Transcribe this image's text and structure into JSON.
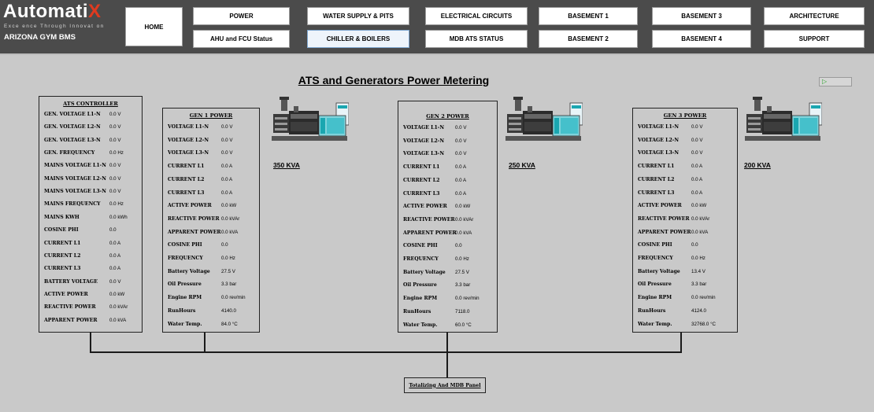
{
  "brand": {
    "logo_main": "Automati",
    "logo_x": "X",
    "tagline": "Exce ence Through Innovat on",
    "site_name": "ARIZONA GYM BMS"
  },
  "nav": {
    "home": "HOME",
    "row1": [
      "POWER",
      "WATER SUPPLY & PITS",
      "ELECTRICAL CIRCUITS",
      "BASEMENT 1",
      "BASEMENT 3",
      "ARCHITECTURE"
    ],
    "row2": [
      "AHU and FCU Status",
      "CHILLER & BOILERS",
      "MDB ATS STATUS",
      "BASEMENT 2",
      "BASEMENT 4",
      "SUPPORT"
    ]
  },
  "page": {
    "title": "ATS and Generators Power Metering",
    "indicator": "▷"
  },
  "ats": {
    "title": "ATS CONTROLLER",
    "rows": [
      {
        "label": "GEN. VOLTAGE L1-N",
        "value": "0.0 V"
      },
      {
        "label": "GEN. VOLTAGE L2-N",
        "value": "0.0 V"
      },
      {
        "label": "GEN. VOLTAGE L3-N",
        "value": "0.0 V"
      },
      {
        "label": "GEN. FREQUENCY",
        "value": "0.0 Hz"
      },
      {
        "label": "MAINS VOLTAGE L1-N",
        "value": "0.0 V"
      },
      {
        "label": "MAINS VOLTAGE L2-N",
        "value": "0.0 V"
      },
      {
        "label": "MAINS VOLTAGE L3-N",
        "value": "0.0 V"
      },
      {
        "label": "MAINS FREQUENCY",
        "value": "0.0 Hz"
      },
      {
        "label": "MAINS KWH",
        "value": "0.0 kWh"
      },
      {
        "label": "COSINE PHI",
        "value": "0.0"
      },
      {
        "label": "CURRENT L1",
        "value": "0.0 A"
      },
      {
        "label": "CURRENT L2",
        "value": "0.0 A"
      },
      {
        "label": "CURRENT L3",
        "value": "0.0 A"
      },
      {
        "label": "BATTERY VOLTAGE",
        "value": "0.0 V"
      },
      {
        "label": "ACTIVE POWER",
        "value": "0.0 kW"
      },
      {
        "label": "REACTIVE POWER",
        "value": "0.0 kVAr"
      },
      {
        "label": "APPARENT POWER",
        "value": "0.0 kVA"
      }
    ]
  },
  "gens": [
    {
      "title": "GEN 1 POWER",
      "kva": "350 KVA",
      "rows": [
        {
          "label": "VOLTAGE L1-N",
          "value": "0.0 V"
        },
        {
          "label": "VOLTAGE L2-N",
          "value": "0.0 V"
        },
        {
          "label": "VOLTAGE L3-N",
          "value": "0.0 V"
        },
        {
          "label": "CURRENT L1",
          "value": "0.0 A"
        },
        {
          "label": "CURRENT L2",
          "value": "0.0 A"
        },
        {
          "label": "CURRENT L3",
          "value": "0.0 A"
        },
        {
          "label": "ACTIVE POWER",
          "value": "0.0 kW"
        },
        {
          "label": "REACTIVE POWER",
          "value": "0.0 kVAr"
        },
        {
          "label": "APPARENT POWER",
          "value": "0.0 kVA"
        },
        {
          "label": "COSINE PHI",
          "value": "0.0"
        },
        {
          "label": "FREQUENCY",
          "value": "0.0 Hz"
        },
        {
          "label": "Battery Voltage",
          "value": "27.5 V"
        },
        {
          "label": "Oil Pressure",
          "value": "3.3 bar"
        },
        {
          "label": "Engine RPM",
          "value": "0.0 rev/min"
        },
        {
          "label": "RunHours",
          "value": "4140.0"
        },
        {
          "label": "Water Temp.",
          "value": "84.0 °C"
        }
      ]
    },
    {
      "title": "GEN 2 POWER",
      "kva": "250 KVA",
      "rows": [
        {
          "label": "VOLTAGE L1-N",
          "value": "0.0 V"
        },
        {
          "label": "VOLTAGE L2-N",
          "value": "0.0 V"
        },
        {
          "label": "VOLTAGE L3-N",
          "value": "0.0 V"
        },
        {
          "label": "CURRENT L1",
          "value": "0.0 A"
        },
        {
          "label": "CURRENT L2",
          "value": "0.0 A"
        },
        {
          "label": "CURRENT L3",
          "value": "0.0 A"
        },
        {
          "label": "ACTIVE POWER",
          "value": "0.0 kW"
        },
        {
          "label": "REACTIVE POWER",
          "value": "0.0 kVAr"
        },
        {
          "label": "APPARENT POWER",
          "value": "0.0 kVA"
        },
        {
          "label": "COSINE PHI",
          "value": "0.0"
        },
        {
          "label": "FREQUENCY",
          "value": "0.0 Hz"
        },
        {
          "label": "Battery Voltage",
          "value": "27.5 V"
        },
        {
          "label": "Oil Pressure",
          "value": "3.3 bar"
        },
        {
          "label": "Engine RPM",
          "value": "0.0 rev/min"
        },
        {
          "label": "RunHours",
          "value": "7118.0"
        },
        {
          "label": "Water Temp.",
          "value": "60.0 °C"
        }
      ]
    },
    {
      "title": "GEN 3 POWER",
      "kva": "200 KVA",
      "rows": [
        {
          "label": "VOLTAGE L1-N",
          "value": "0.0 V"
        },
        {
          "label": "VOLTAGE L2-N",
          "value": "0.0 V"
        },
        {
          "label": "VOLTAGE L3-N",
          "value": "0.0 V"
        },
        {
          "label": "CURRENT L1",
          "value": "0.0 A"
        },
        {
          "label": "CURRENT L2",
          "value": "0.0 A"
        },
        {
          "label": "CURRENT L3",
          "value": "0.0 A"
        },
        {
          "label": "ACTIVE POWER",
          "value": "0.0 kW"
        },
        {
          "label": "REACTIVE POWER",
          "value": "0.0 kVAr"
        },
        {
          "label": "APPARENT POWER",
          "value": "0.0 kVA"
        },
        {
          "label": "COSINE PHI",
          "value": "0.0"
        },
        {
          "label": "FREQUENCY",
          "value": "0.0 Hz"
        },
        {
          "label": "Battery Voltage",
          "value": "13.4 V"
        },
        {
          "label": "Oil Pressure",
          "value": "3.3 bar"
        },
        {
          "label": "Engine RPM",
          "value": "0.0 rev/min"
        },
        {
          "label": "RunHours",
          "value": "4124.0"
        },
        {
          "label": "Water Temp.",
          "value": "32768.0 °C"
        }
      ]
    }
  ],
  "mdb_panel": "Totalizing And MDB Panel",
  "colors": {
    "topbar": "#4b4b4b",
    "background": "#c9c9c9",
    "logo_accent": "#e03a1f",
    "genset_teal": "#1aa6b0"
  }
}
